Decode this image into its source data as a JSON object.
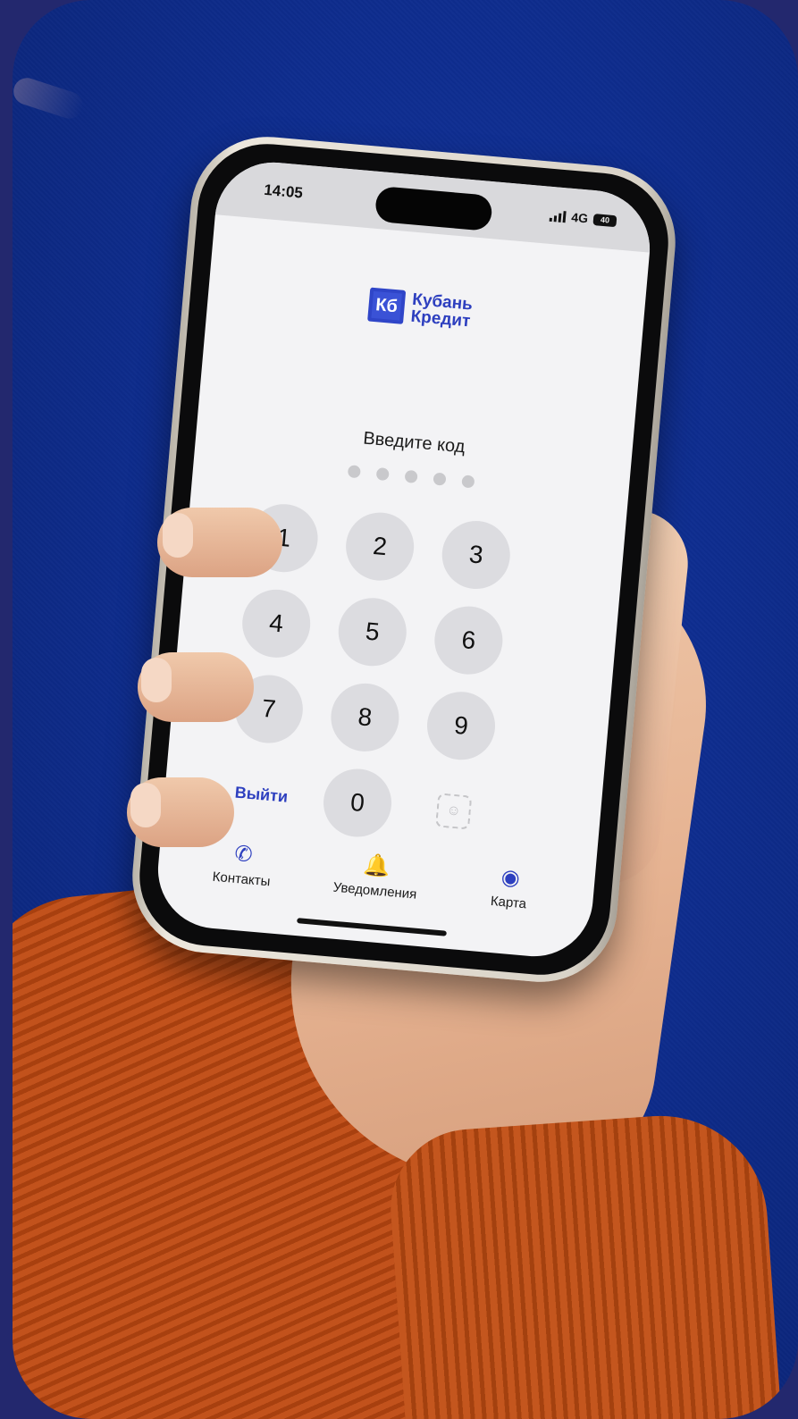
{
  "status_bar": {
    "time": "14:05",
    "network": "4G",
    "battery": "40"
  },
  "logo": {
    "mark": "Кб",
    "line1": "Кубань",
    "line2": "Кредит"
  },
  "pin": {
    "prompt": "Введите код",
    "dots_total": 5,
    "dots_filled": 0
  },
  "keypad": {
    "keys": [
      "1",
      "2",
      "3",
      "4",
      "5",
      "6",
      "7",
      "8",
      "9"
    ],
    "zero": "0",
    "exit_label": "Выйти",
    "biometric_icon": "face-id-icon"
  },
  "tabbar": {
    "items": [
      {
        "label": "Контакты",
        "icon": "phone-icon"
      },
      {
        "label": "Уведомления",
        "icon": "bell-icon"
      },
      {
        "label": "Карта",
        "icon": "map-pin-icon"
      }
    ]
  },
  "colors": {
    "background": "#0e2d8f",
    "brand": "#2d3fbf",
    "sleeve": "#c2521c"
  }
}
